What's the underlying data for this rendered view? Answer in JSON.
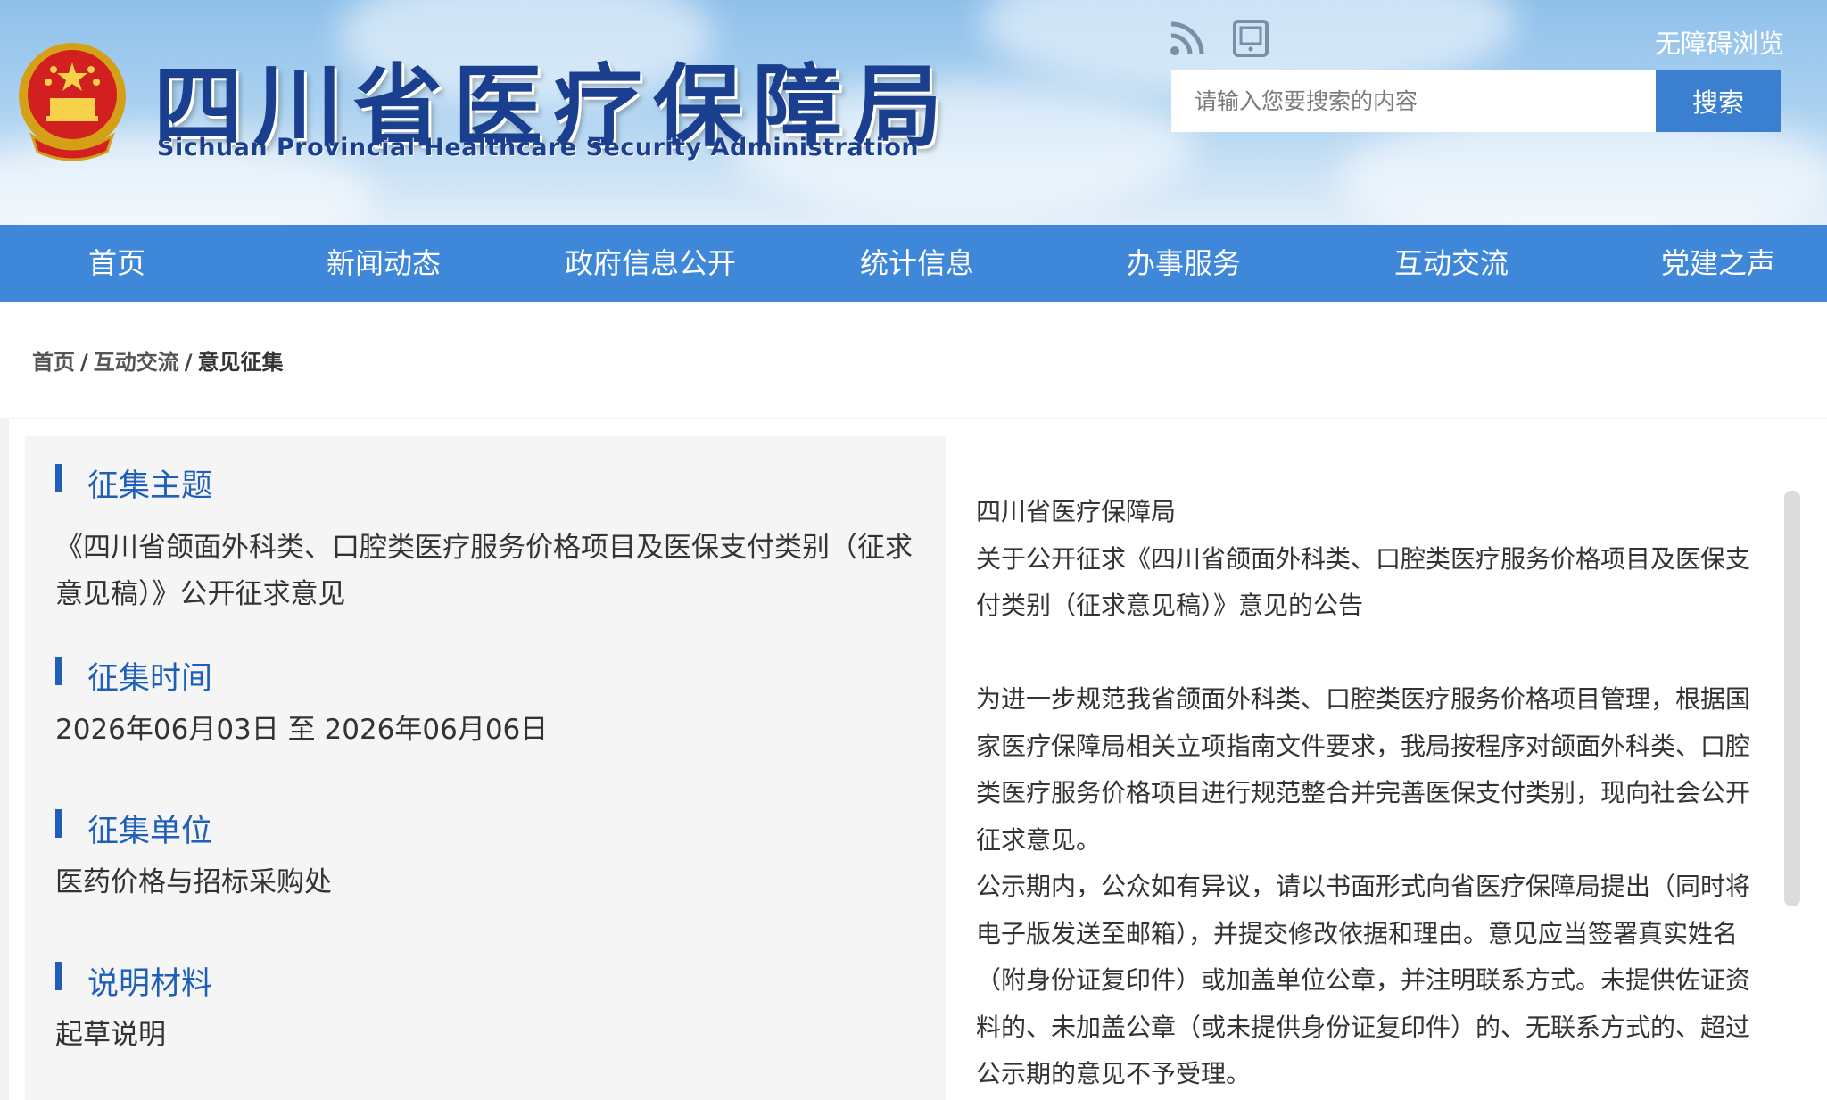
{
  "header": {
    "title_cn": "四川省医疗保障局",
    "title_en": "Sichuan Provincial Healthcare Security Administration",
    "emblem_icon": "national-emblem-icon",
    "rss_icon": "rss-icon",
    "tablet_icon": "tablet-icon",
    "accessibility_link": "无障碍浏览",
    "search": {
      "placeholder": "请输入您要搜索的内容",
      "button_label": "搜索"
    },
    "colors": {
      "title": "#1b3f8f",
      "search_button": "#3a7fd0"
    }
  },
  "nav": {
    "background": "#3f87d9",
    "items": [
      {
        "label": "首页"
      },
      {
        "label": "新闻动态"
      },
      {
        "label": "政府信息公开"
      },
      {
        "label": "统计信息"
      },
      {
        "label": "办事服务"
      },
      {
        "label": "互动交流"
      },
      {
        "label": "党建之声"
      }
    ]
  },
  "breadcrumb": {
    "items": [
      "首页",
      "互动交流",
      "意见征集"
    ],
    "separator": "/"
  },
  "details": {
    "topic": {
      "heading": "征集主题",
      "value": "《四川省颌面外科类、口腔类医疗服务价格项目及医保支付类别（征求意见稿）》公开征求意见"
    },
    "time": {
      "heading": "征集时间",
      "value": "2026年06月03日 至 2026年06月06日"
    },
    "unit": {
      "heading": "征集单位",
      "value": "医药价格与招标采购处"
    },
    "materials": {
      "heading": "说明材料",
      "value": "起草说明"
    },
    "accent_color": "#1f5fb8"
  },
  "notice": {
    "org": "四川省医疗保障局",
    "title": "关于公开征求《四川省颌面外科类、口腔类医疗服务价格项目及医保支付类别（征求意见稿）》意见的公告",
    "paragraph1": "为进一步规范我省颌面外科类、口腔类医疗服务价格项目管理，根据国家医疗保障局相关立项指南文件要求，我局按程序对颌面外科类、口腔类医疗服务价格项目进行规范整合并完善医保支付类别，现向社会公开征求意见。",
    "paragraph2": "公示期内，公众如有异议，请以书面形式向省医疗保障局提出（同时将电子版发送至邮箱），并提交修改依据和理由。意见应当签署真实姓名（附身份证复印件）或加盖单位公章，并注明联系方式。未提供佐证资料的、未加盖公章（或未提供身份证复印件）的、无联系方式的、超过公示期的意见不予受理。"
  }
}
